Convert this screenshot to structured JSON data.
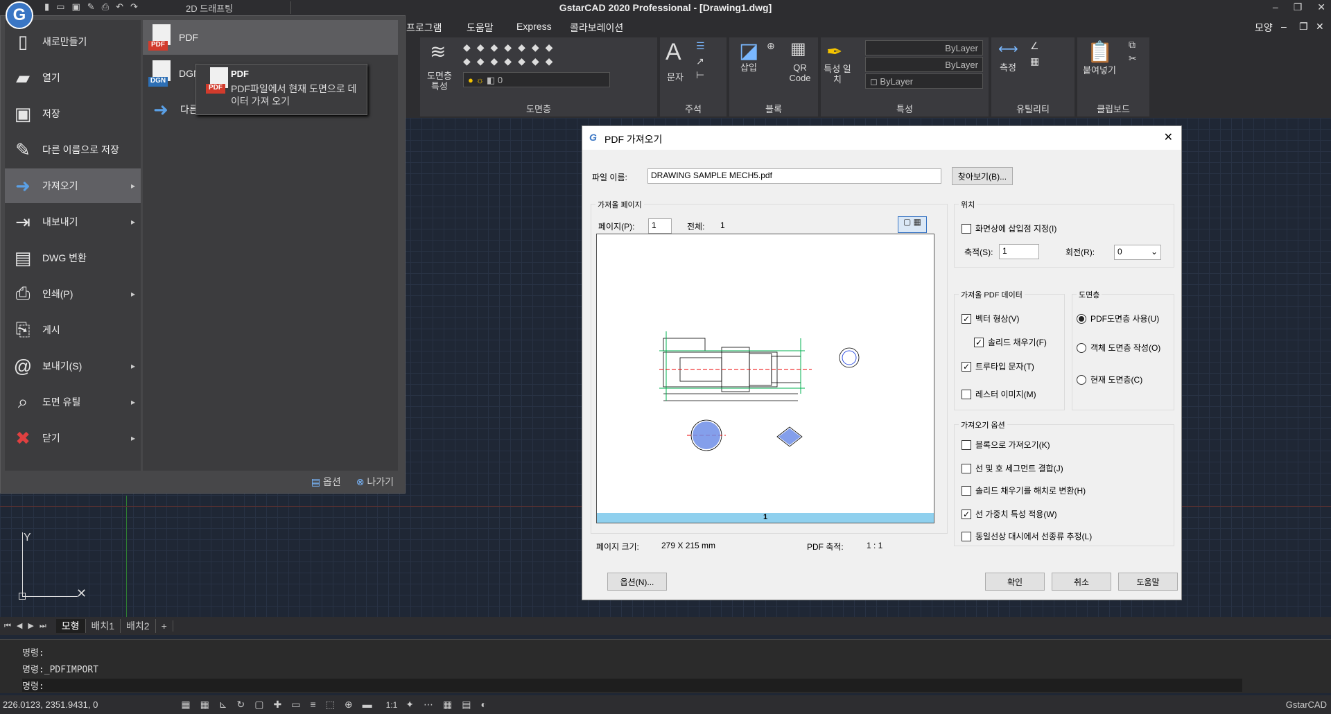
{
  "titlebar": {
    "title": "GstarCAD 2020 Professional - [Drawing1.dwg]",
    "workspace": "2D 드래프팅",
    "logo_letter": "G"
  },
  "menubar": {
    "items": [
      "프로그램",
      "도움말",
      "Express",
      "콜라보레이션"
    ],
    "shape": "모양"
  },
  "ribbon": {
    "layers": {
      "btn": "도면층 특성",
      "label": "도면층",
      "layer_value": "0"
    },
    "annotation": {
      "text_btn": "문자",
      "label": "주석"
    },
    "block": {
      "insert": "삽입",
      "qr": "QR Code",
      "label": "블록"
    },
    "properties": {
      "match": "특성 일치",
      "bylayer1": "ByLayer",
      "bylayer2": "ByLayer",
      "bylayer3": "ByLayer",
      "label": "특성"
    },
    "utility": {
      "measure": "측정",
      "label": "유틸리티"
    },
    "clipboard": {
      "paste": "붙여넣기",
      "label": "클립보드"
    }
  },
  "file_menu": {
    "items": [
      {
        "label": "새로만들기",
        "icon": "new-file-icon"
      },
      {
        "label": "열기",
        "icon": "open-folder-icon"
      },
      {
        "label": "저장",
        "icon": "save-icon"
      },
      {
        "label": "다른 이름으로 저장",
        "icon": "save-as-icon"
      },
      {
        "label": "가져오기",
        "icon": "import-icon",
        "selected": true,
        "arrow": true
      },
      {
        "label": "내보내기",
        "icon": "export-icon",
        "arrow": true
      },
      {
        "label": "DWG 변환",
        "icon": "dwg-convert-icon"
      },
      {
        "label": "인쇄(P)",
        "icon": "print-icon",
        "arrow": true
      },
      {
        "label": "게시",
        "icon": "publish-icon"
      },
      {
        "label": "보내기(S)",
        "icon": "send-icon",
        "arrow": true
      },
      {
        "label": "도면 유틸",
        "icon": "drawing-utility-icon",
        "arrow": true
      },
      {
        "label": "닫기",
        "icon": "close-file-icon",
        "arrow": true
      }
    ],
    "sub_items": [
      {
        "label": "PDF",
        "tag": "PDF"
      },
      {
        "label": "DGN",
        "tag": "DGN"
      },
      {
        "label": "다른 형식"
      }
    ],
    "footer": {
      "options": "옵션",
      "exit": "나가기"
    },
    "tooltip": {
      "title": "PDF",
      "body": "PDF파일에서 현재 도면으로 데이터 가져 오기",
      "tag": "PDF"
    }
  },
  "layout_tabs": [
    "모형",
    "배치1",
    "배치2",
    "+"
  ],
  "command": {
    "lines": [
      "명령:",
      "명령:_PDFIMPORT",
      "명령:"
    ]
  },
  "status": {
    "coords": "226.0123, 2351.9431, 0",
    "scale": "1:1",
    "app": "GstarCAD"
  },
  "dialog": {
    "title": "PDF 가져오기",
    "file_label": "파일 이름:",
    "file_value": "DRAWING SAMPLE MECH5.pdf",
    "browse": "찾아보기(B)...",
    "page_group": "가져올 페이지",
    "page_label": "페이지(P):",
    "page_value": "1",
    "total_label": "전체:",
    "total_value": "1",
    "preview_page": "1",
    "page_size_label": "페이지 크기:",
    "page_size_value": "279 X 215 mm",
    "pdf_scale_label": "PDF 축적:",
    "pdf_scale_value": "1 : 1",
    "position_group": "위치",
    "onscreen": "화면상에 삽입점 지정(I)",
    "scale_label": "축적(S):",
    "scale_value": "1",
    "rotation_label": "회전(R):",
    "rotation_value": "0",
    "pdfdata_group": "가져올 PDF 데이터",
    "vector": "벡터 형상(V)",
    "solid_fill": "솔리드 채우기(F)",
    "truetype": "트루타입 문자(T)",
    "raster": "레스터 이미지(M)",
    "layer_group": "도면층",
    "use_pdf_layer": "PDF도면층 사용(U)",
    "object_layer": "객체 도면층 작성(O)",
    "current_layer": "현재 도면층(C)",
    "options_group": "가져오기 옵션",
    "as_block": "블록으로 가져오기(K)",
    "join_seg": "선 및 호 세그먼트 결합(J)",
    "solid_hatch": "솔리드 채우기를 해치로 변환(H)",
    "lineweight": "선 가중치 특성 적용(W)",
    "infer_lt": "동일선상 대시에서 선종류 추정(L)",
    "options_btn": "옵션(N)...",
    "ok": "확인",
    "cancel": "취소",
    "help": "도움말"
  }
}
